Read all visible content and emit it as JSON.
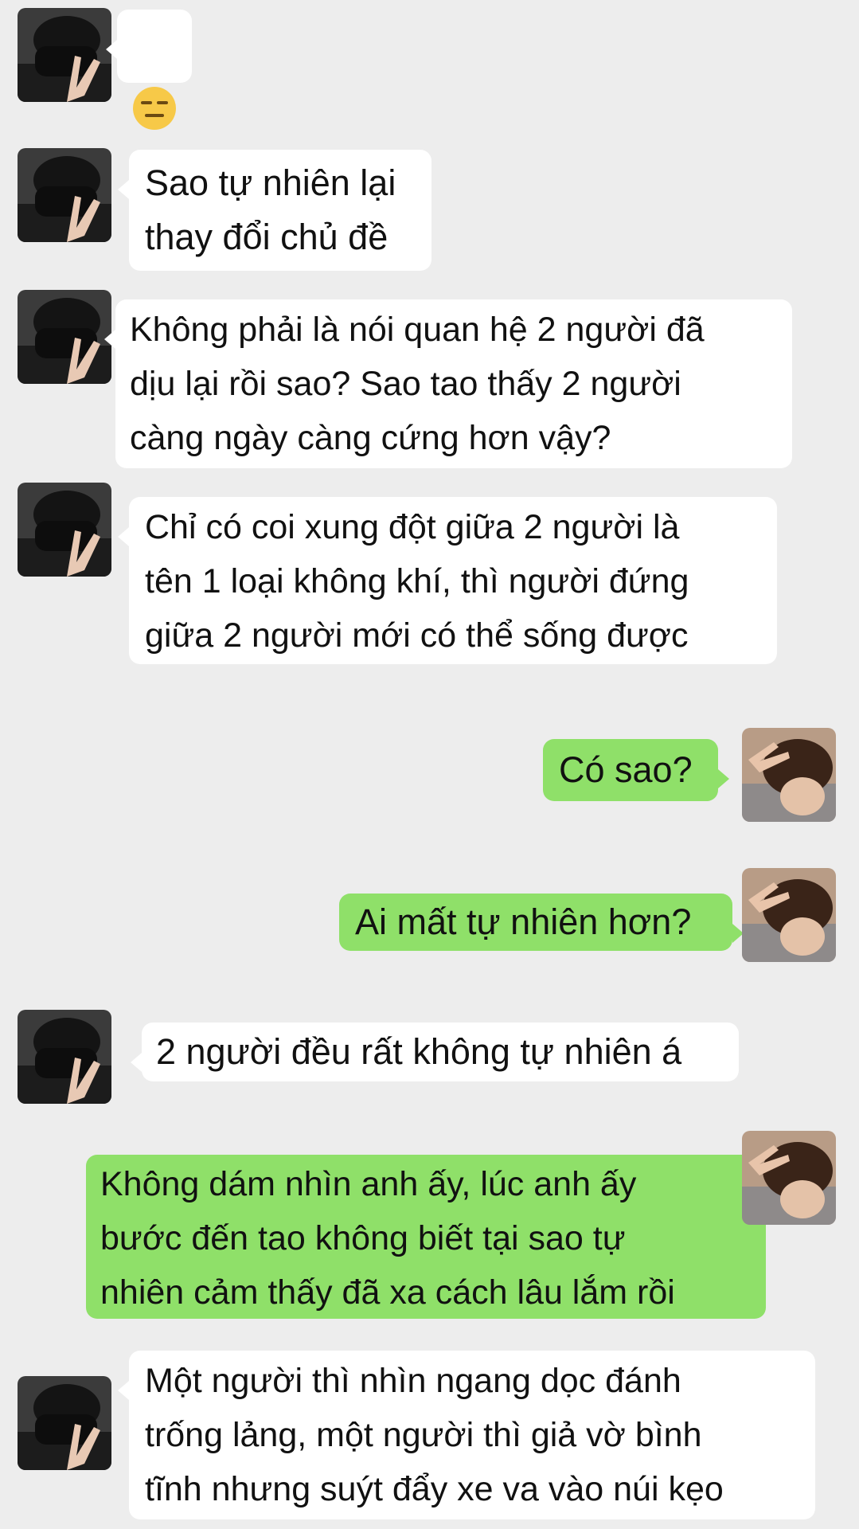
{
  "messages": [
    {
      "side": "left",
      "type": "emoji",
      "emoji_name": "expressionless-face-emoji"
    },
    {
      "side": "left",
      "text": "Sao tự nhiên lại\nthay đổi chủ đề"
    },
    {
      "side": "left",
      "text": "Không phải là nói quan hệ 2 người đã\ndịu lại rồi sao? Sao tao thấy 2 người\ncàng ngày càng cứng hơn vậy?"
    },
    {
      "side": "left",
      "text": "Chỉ có coi xung đột giữa 2 người là\ntên 1 loại không khí, thì người đứng\ngiữa 2 người mới có thể sống được"
    },
    {
      "side": "right",
      "text": "Có sao?"
    },
    {
      "side": "right",
      "text": "Ai mất tự nhiên hơn?"
    },
    {
      "side": "left",
      "text": "2 người đều rất không tự nhiên á"
    },
    {
      "side": "right",
      "text": "Không dám nhìn anh ấy, lúc anh ấy\nbước đến tao không biết tại sao tự\nnhiên cảm thấy đã xa cách lâu lắm rồi"
    },
    {
      "side": "left",
      "text": "Một người thì nhìn ngang dọc đánh\ntrống lảng, một người thì giả vờ bình\ntĩnh nhưng suýt đẩy xe va vào núi kẹo"
    }
  ],
  "colors": {
    "background": "#ededed",
    "incoming_bubble": "#ffffff",
    "outgoing_bubble": "#8fe069"
  },
  "icons": {
    "left_avatar": "masked-person-avatar",
    "right_avatar": "peace-sign-person-avatar"
  }
}
